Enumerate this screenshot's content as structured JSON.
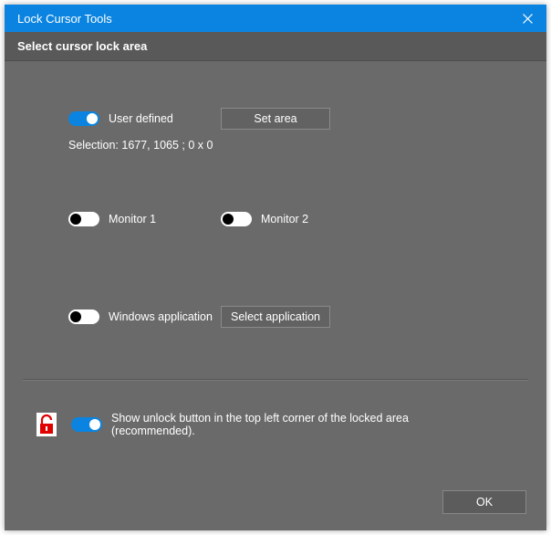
{
  "window": {
    "title": "Lock Cursor Tools",
    "subtitle": "Select cursor lock area"
  },
  "options": {
    "user_defined": {
      "label": "User defined",
      "button": "Set area",
      "selection_label": "Selection: 1677, 1065 ;  0 x 0"
    },
    "monitor1": {
      "label": "Monitor 1"
    },
    "monitor2": {
      "label": "Monitor 2"
    },
    "windows_app": {
      "label": "Windows application",
      "button": "Select application"
    }
  },
  "footer_option": {
    "label": "Show unlock button in the top left corner of the locked area (recommended)."
  },
  "buttons": {
    "ok": "OK"
  },
  "colors": {
    "accent": "#0a84e0",
    "panel_bg": "#6a6a6a"
  }
}
